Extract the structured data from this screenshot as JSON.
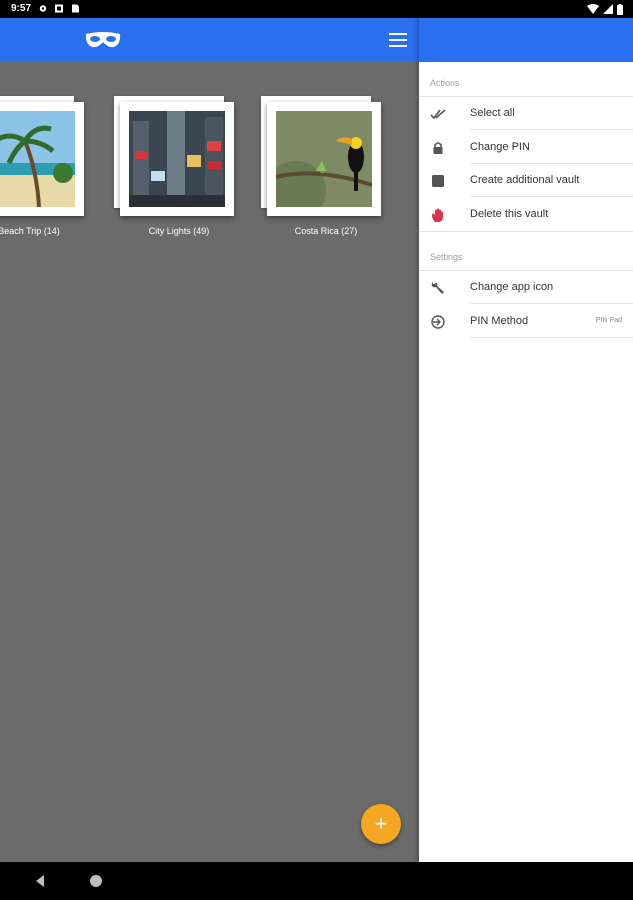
{
  "status_bar": {
    "time": "9:57"
  },
  "albums": [
    {
      "label": "Beach Trip (14)"
    },
    {
      "label": "City Lights (49)"
    },
    {
      "label": "Costa Rica (27)"
    }
  ],
  "fab": {
    "label": "+"
  },
  "drawer": {
    "actions_title": "Actions",
    "actions": [
      {
        "label": "Select all",
        "icon": "double-check-icon"
      },
      {
        "label": "Change PIN",
        "icon": "lock-icon"
      },
      {
        "label": "Create additional vault",
        "icon": "vault-icon"
      },
      {
        "label": "Delete this vault",
        "icon": "hand-icon"
      }
    ],
    "settings_title": "Settings",
    "settings": [
      {
        "label": "Change app icon",
        "icon": "wrench-icon"
      },
      {
        "label": "PIN Method",
        "icon": "login-icon",
        "value": "PIN Pad"
      }
    ]
  },
  "colors": {
    "primary": "#2a6ff0",
    "accent": "#f5a623",
    "background": "#6b6b6b"
  }
}
